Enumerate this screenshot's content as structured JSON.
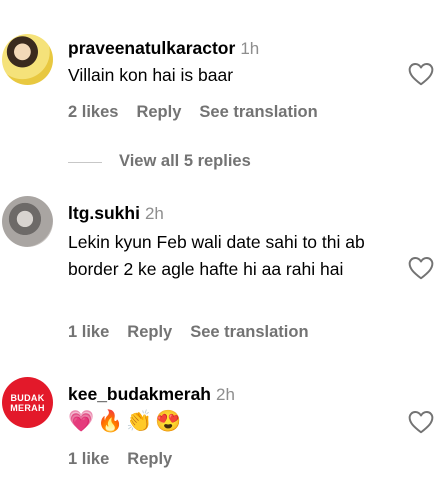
{
  "comments": [
    {
      "username": "praveenatulkaractor",
      "time": "1h",
      "text": "Villain kon hai is baar",
      "likes": "2 likes",
      "reply": "Reply",
      "translate": "See translation",
      "view_replies": "View all 5 replies"
    },
    {
      "username": "ltg.sukhi",
      "time": "2h",
      "text": "Lekin kyun Feb wali date sahi to thi ab border 2 ke agle hafte hi aa rahi hai",
      "likes": "1 like",
      "reply": "Reply",
      "translate": "See translation"
    },
    {
      "username": "kee_budakmerah",
      "time": "2h",
      "avatar_text": [
        "BUDAK",
        "MERAH"
      ],
      "emojis": [
        "💗",
        "🔥",
        "👏",
        "😍"
      ],
      "likes": "1 like",
      "reply": "Reply"
    }
  ],
  "icons": {
    "heart": "heart-outline-icon"
  },
  "colors": {
    "secondary_text": "#737373",
    "timestamp": "#8e8e8e",
    "avatar_red": "#e3192a"
  }
}
